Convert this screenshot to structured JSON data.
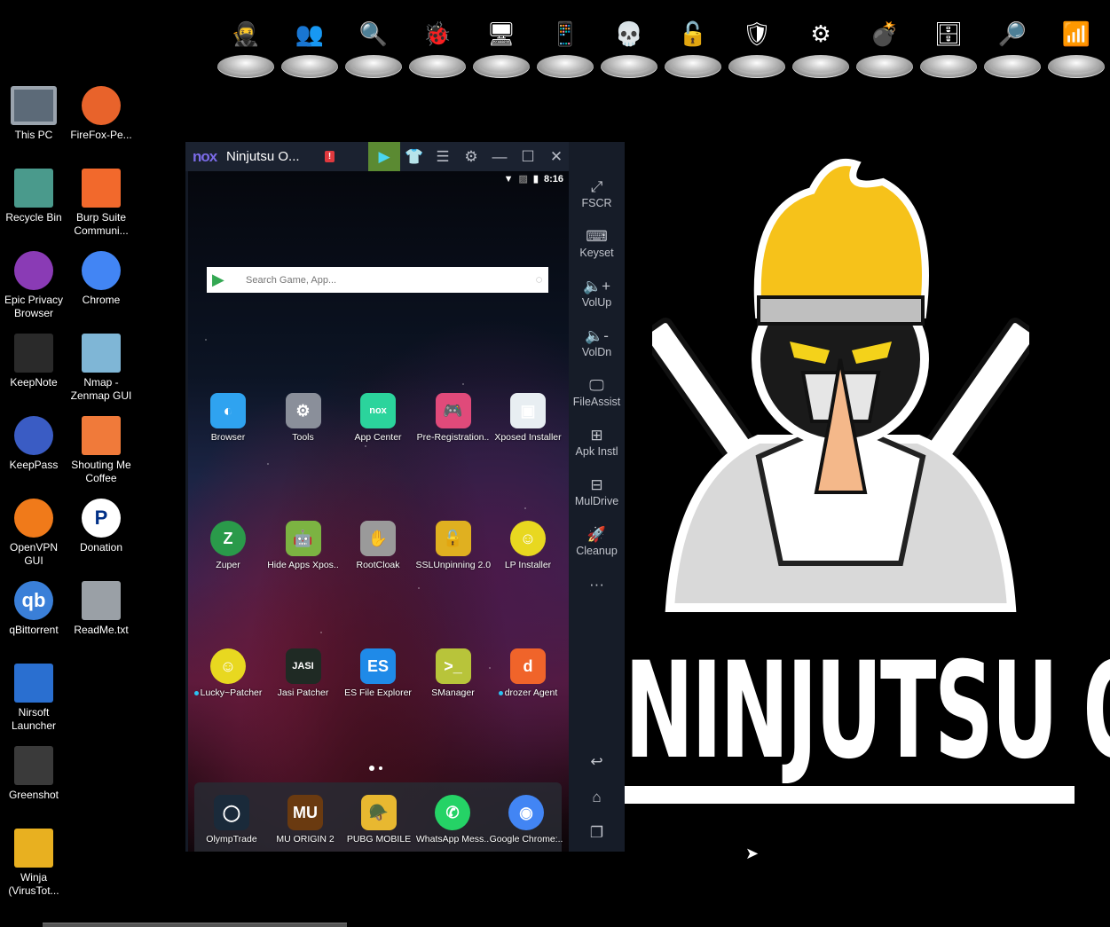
{
  "dock": [
    {
      "name": "ninjutsu",
      "glyph": "🥷",
      "label": "Ninjutsu"
    },
    {
      "name": "hacker-team",
      "glyph": "👥"
    },
    {
      "name": "search-tool",
      "glyph": "🔍"
    },
    {
      "name": "bug-network",
      "glyph": "🐞"
    },
    {
      "name": "forensics",
      "glyph": "🖥"
    },
    {
      "name": "mobile-security",
      "glyph": "📱"
    },
    {
      "name": "network-attack",
      "glyph": "💀"
    },
    {
      "name": "password-unlock",
      "glyph": "🔓"
    },
    {
      "name": "firewall-shield",
      "glyph": "🛡"
    },
    {
      "name": "reverse-engineering",
      "glyph": "⚙"
    },
    {
      "name": "dos-attack",
      "glyph": "💣",
      "label": "DOS"
    },
    {
      "name": "server-security",
      "glyph": "🗄"
    },
    {
      "name": "web-bug-scan",
      "glyph": "🔎"
    },
    {
      "name": "wifi-hacker",
      "glyph": "📶"
    }
  ],
  "desktop": [
    {
      "label": "This PC",
      "icon": "monitor",
      "color": "#5c6a78"
    },
    {
      "label": "FireFox-Pe...",
      "icon": "firefox",
      "color": "#e8632b"
    },
    {
      "label": "Recycle Bin",
      "icon": "trash",
      "color": "#4a9a8c"
    },
    {
      "label": "Burp Suite Communi...",
      "icon": "burp",
      "color": "#f2692c"
    },
    {
      "label": "Epic Privacy Browser",
      "icon": "epic",
      "color": "#8a3bb5"
    },
    {
      "label": "Chrome",
      "icon": "chrome",
      "color": "#4285f4"
    },
    {
      "label": "KeepNote",
      "icon": "note",
      "color": "#2a2a2a"
    },
    {
      "label": "Nmap - Zenmap GUI",
      "icon": "eye",
      "color": "#7fb6d6"
    },
    {
      "label": "KeepPass",
      "icon": "lock",
      "color": "#3a5cc4"
    },
    {
      "label": "Shouting Me Coffee",
      "icon": "coffee",
      "color": "#f07a3a"
    },
    {
      "label": "OpenVPN GUI",
      "icon": "vpn",
      "color": "#f07a1a"
    },
    {
      "label": "Donation",
      "icon": "paypal",
      "color": "#ffffff"
    },
    {
      "label": "qBittorrent",
      "icon": "qb",
      "color": "#3a7fd8"
    },
    {
      "label": "ReadMe.txt",
      "icon": "file",
      "color": "#9aa0a6"
    },
    {
      "label": "Nirsoft Launcher",
      "icon": "hand",
      "color": "#2a6fd0"
    },
    {
      "label": "Greenshot",
      "icon": "greenshot",
      "color": "#3a3a3a"
    },
    {
      "label": "Winja (VirusTot...",
      "icon": "winja",
      "color": "#e8b020"
    }
  ],
  "nox": {
    "logo": "nox",
    "title": "Ninjutsu O...",
    "alert": "!",
    "toolbar": [
      {
        "name": "play-store",
        "glyph": "▶"
      },
      {
        "name": "theme",
        "glyph": "👕"
      },
      {
        "name": "menu",
        "glyph": "☰"
      },
      {
        "name": "settings",
        "glyph": "⚙"
      },
      {
        "name": "minimize",
        "glyph": "—"
      },
      {
        "name": "maximize",
        "glyph": "☐"
      },
      {
        "name": "close",
        "glyph": "✕"
      },
      {
        "name": "collapse-sidebar",
        "glyph": "«"
      }
    ],
    "status": {
      "time": "8:16"
    },
    "search": {
      "placeholder": "Search Game, App..."
    },
    "apps": [
      [
        {
          "label": "Browser",
          "glyph": "◐",
          "bg": "#2fa3f0",
          "dot": false
        },
        {
          "label": "Tools",
          "glyph": "⚙",
          "bg": "#8a8f9a",
          "dot": false
        },
        {
          "label": "App Center",
          "glyph": "nox",
          "bg": "#2bd49c",
          "dot": false
        },
        {
          "label": "Pre-Registration..",
          "glyph": "🎮",
          "bg": "#e04a7a",
          "dot": false
        },
        {
          "label": "Xposed Installer",
          "glyph": "▣",
          "bg": "#e8eef2",
          "dot": false
        }
      ],
      [
        {
          "label": "Zuper",
          "glyph": "Z",
          "bg": "#2a9a4a",
          "dot": false
        },
        {
          "label": "Hide Apps Xpos..",
          "glyph": "🤖",
          "bg": "#7cb342",
          "dot": false
        },
        {
          "label": "RootCloak",
          "glyph": "✋",
          "bg": "#9a9a9a",
          "dot": false
        },
        {
          "label": "SSLUnpinning 2.0",
          "glyph": "🔓",
          "bg": "#e0b020",
          "dot": false
        },
        {
          "label": "LP  Installer",
          "glyph": "☺",
          "bg": "#e8d820",
          "dot": false
        }
      ],
      [
        {
          "label": "Lucky~Patcher",
          "glyph": "☺",
          "bg": "#e8d820",
          "dot": true
        },
        {
          "label": "Jasi Patcher",
          "glyph": "JASI",
          "bg": "#1f2a24",
          "dot": false
        },
        {
          "label": "ES File Explorer",
          "glyph": "ES",
          "bg": "#1f8ae8",
          "dot": false
        },
        {
          "label": "SManager",
          "glyph": ">_",
          "bg": "#b8c43a",
          "dot": false
        },
        {
          "label": "drozer Agent",
          "glyph": "d",
          "bg": "#f0642a",
          "dot": true
        }
      ]
    ],
    "pager": {
      "pages": 2,
      "current": 1
    },
    "dock_apps": [
      {
        "label": "OlympTrade",
        "glyph": "◯",
        "bg": "#1a2a3a"
      },
      {
        "label": "MU ORIGIN 2",
        "glyph": "MU",
        "bg": "#6a3a10"
      },
      {
        "label": "PUBG MOBILE",
        "glyph": "🪖",
        "bg": "#e8b830"
      },
      {
        "label": "WhatsApp Mess..",
        "glyph": "✆",
        "bg": "#25d366"
      },
      {
        "label": "Google Chrome:..",
        "glyph": "◉",
        "bg": "#4285f4"
      }
    ],
    "sidebar": [
      {
        "name": "fullscreen",
        "glyph": "⤢",
        "label": "FSCR"
      },
      {
        "name": "keyset",
        "glyph": "⌨",
        "label": "Keyset"
      },
      {
        "name": "volume-up",
        "glyph": "🔈+",
        "label": "VolUp"
      },
      {
        "name": "volume-down",
        "glyph": "🔈-",
        "label": "VolDn"
      },
      {
        "name": "file-assist",
        "glyph": "🖵",
        "label": "FileAssist"
      },
      {
        "name": "apk-install",
        "glyph": "⊞",
        "label": "Apk Instl"
      },
      {
        "name": "multi-drive",
        "glyph": "⊟",
        "label": "MulDrive"
      },
      {
        "name": "cleanup",
        "glyph": "🚀",
        "label": "Cleanup"
      },
      {
        "name": "more",
        "glyph": "···",
        "label": ""
      }
    ],
    "nav": [
      {
        "name": "back",
        "glyph": "↩"
      },
      {
        "name": "home",
        "glyph": "⌂"
      },
      {
        "name": "recents",
        "glyph": "❐"
      }
    ]
  },
  "wallpaper": {
    "wordmark": "NINJUTSU OS"
  }
}
